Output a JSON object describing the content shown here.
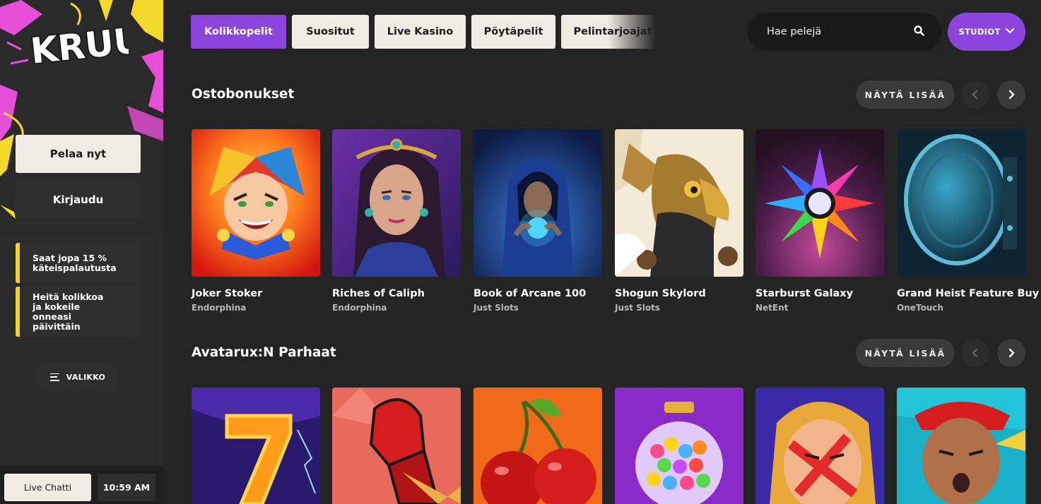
{
  "sidebar": {
    "logo_text": "KRUUNA",
    "play_label": "Pelaa nyt",
    "login_label": "Kirjaudu",
    "promos": [
      "Saat jopa 15 % käteispalautusta",
      "Heitä kolikkoa ja kokeile onneasi päivittäin"
    ],
    "menu_label": "VALIKKO",
    "chat_label": "Live Chatti",
    "time": "10:59 AM"
  },
  "nav": {
    "tabs": [
      "Kolikkopelit",
      "Suositut",
      "Live Kasino",
      "Pöytäpelit",
      "Pelintarjoajat"
    ],
    "active_tab": "Kolikkopelit"
  },
  "search": {
    "placeholder": "Hae pelejä"
  },
  "studios_label": "STUDIOT",
  "colors": {
    "accent": "#8b45dc",
    "promo_bar": "#f2d03a",
    "background": "#242424"
  },
  "sections": [
    {
      "title": "Ostobonukset",
      "show_more": "NÄYTÄ LISÄÄ",
      "games": [
        {
          "name": "Joker Stoker",
          "provider": "Endorphina"
        },
        {
          "name": "Riches of Caliph",
          "provider": "Endorphina"
        },
        {
          "name": "Book of Arcane 100",
          "provider": "Just Slots"
        },
        {
          "name": "Shogun Skylord",
          "provider": "Just Slots"
        },
        {
          "name": "Starburst Galaxy",
          "provider": "NetEnt"
        },
        {
          "name": "Grand Heist Feature Buy",
          "provider": "OneTouch"
        }
      ]
    },
    {
      "title": "Avatarux:N Parhaat",
      "show_more": "NÄYTÄ LISÄÄ",
      "games": []
    }
  ]
}
